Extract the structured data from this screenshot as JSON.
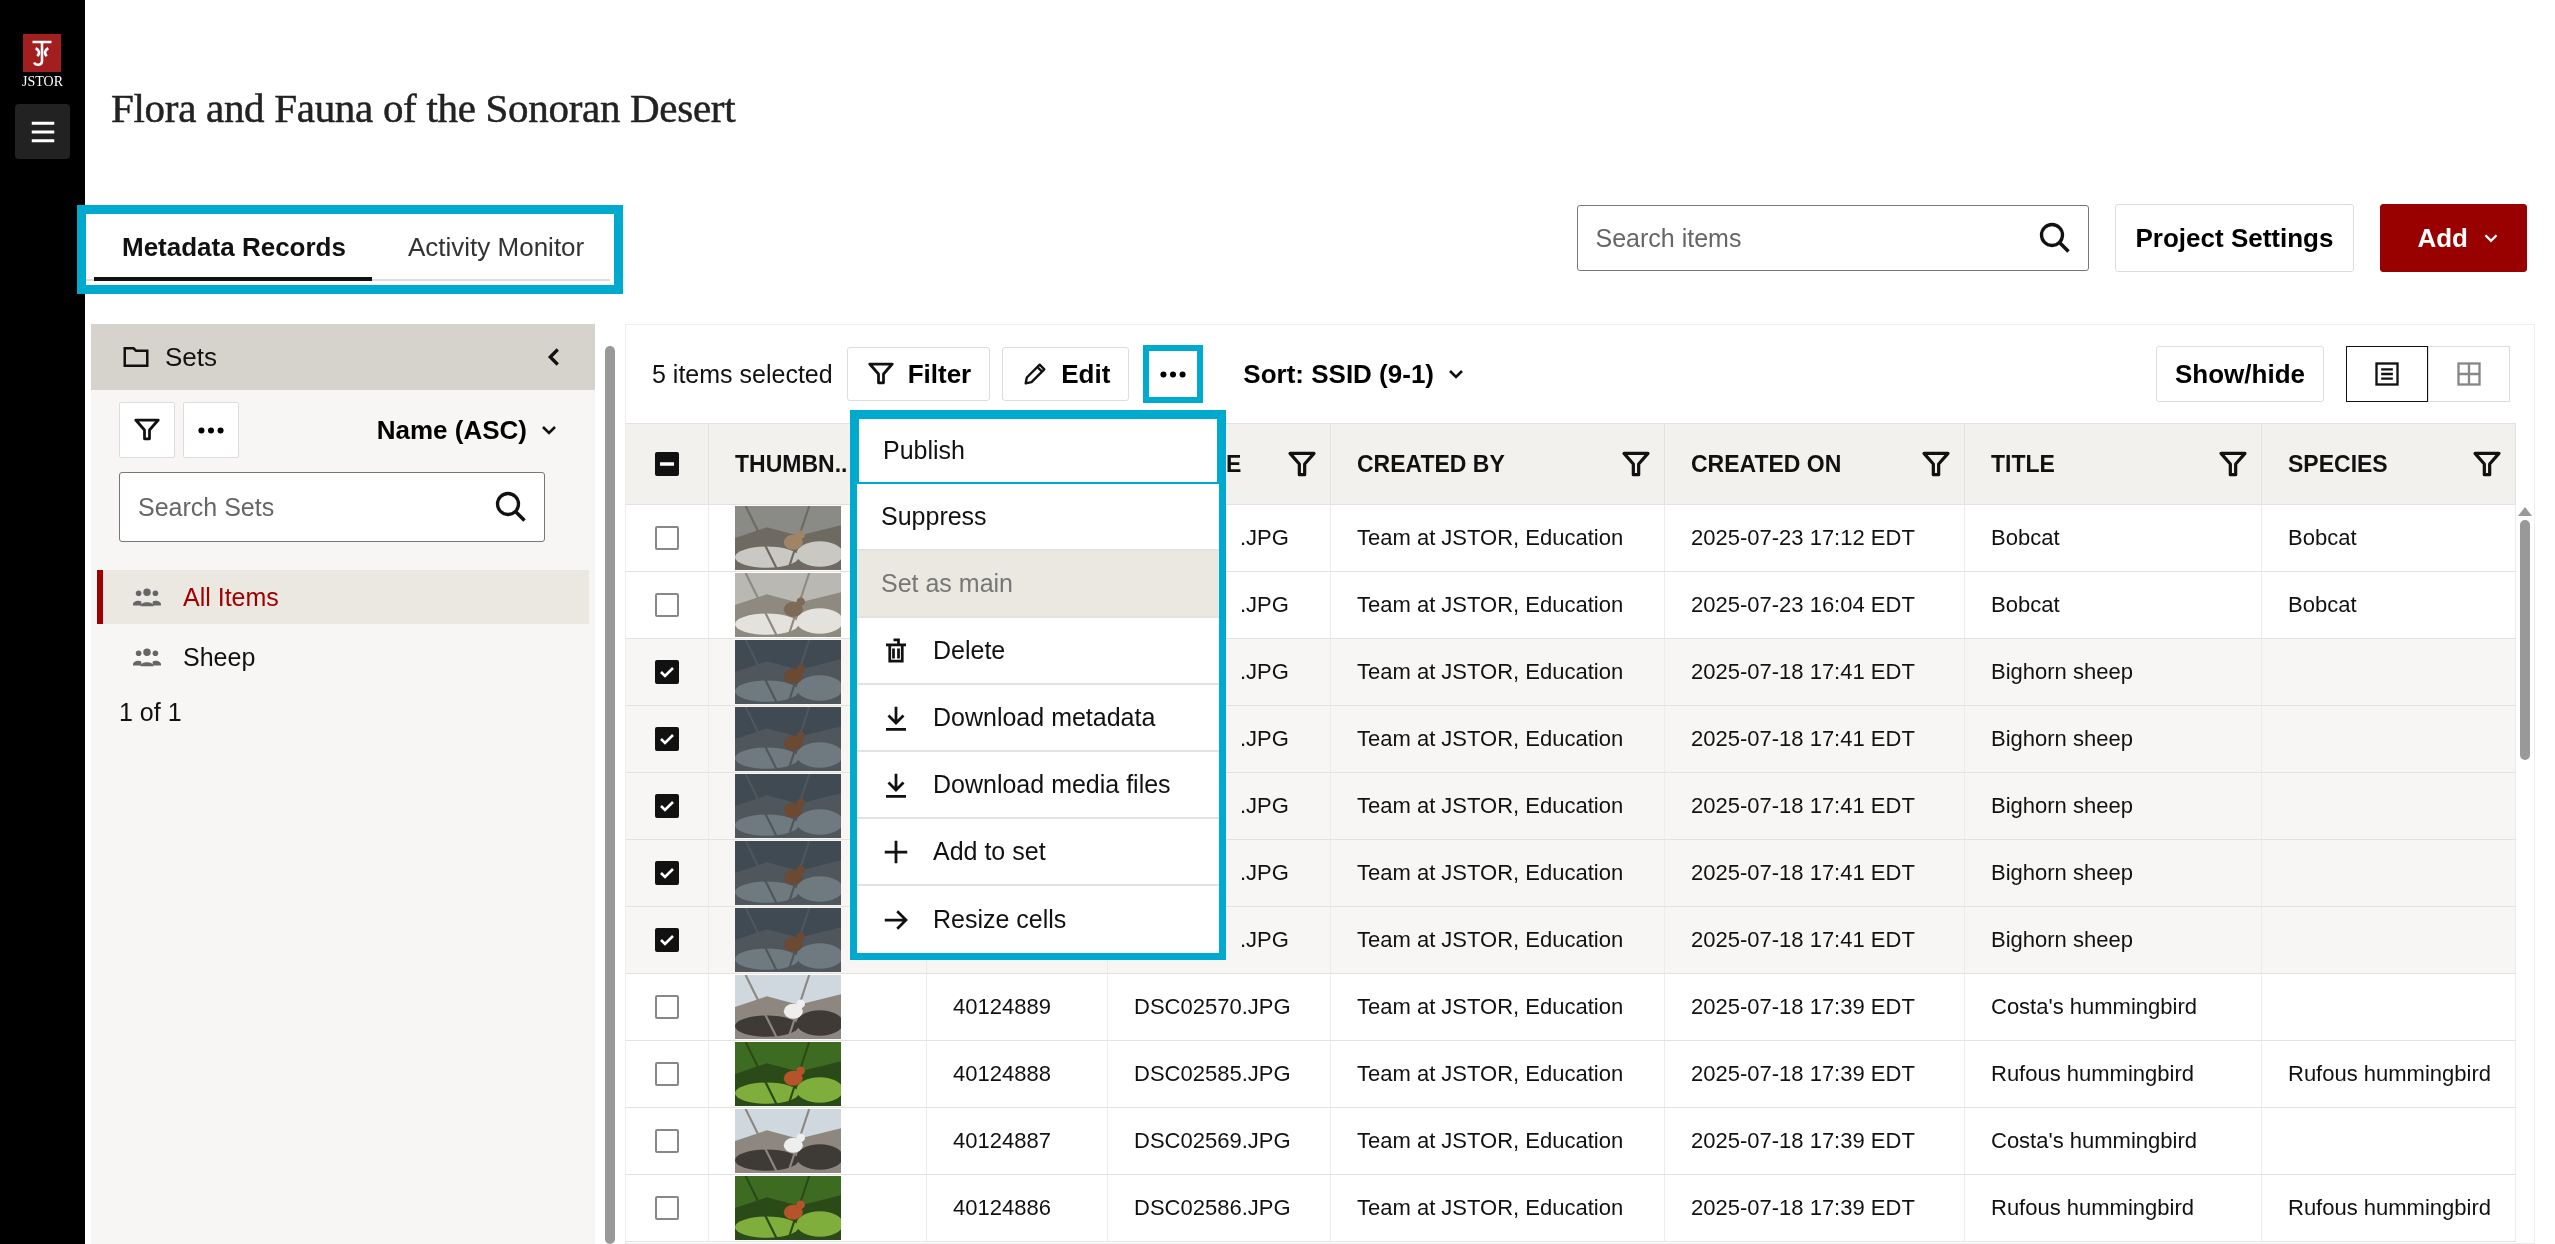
{
  "app": {
    "logo_text": "JSTOR"
  },
  "page": {
    "title": "Flora and Fauna of the Sonoran Desert"
  },
  "tabs": [
    {
      "label": "Metadata Records",
      "selected": true
    },
    {
      "label": "Activity Monitor",
      "selected": false
    }
  ],
  "header_actions": {
    "search": {
      "placeholder": "Search items"
    },
    "settings_button": "Project Settings",
    "add_button": "Add"
  },
  "sets_panel": {
    "title": "Sets",
    "sort": "Name (ASC)",
    "search": {
      "placeholder": "Search Sets"
    },
    "items": [
      {
        "label": "All Items",
        "selected": true
      },
      {
        "label": "Sheep",
        "selected": false
      }
    ],
    "pagination": "1 of 1"
  },
  "toolbar": {
    "selection_count": "5 items selected",
    "filter_button": "Filter",
    "edit_button": "Edit",
    "sort": "Sort: SSID (9-1)",
    "show_hide_button": "Show/hide",
    "views": [
      {
        "kind": "list",
        "selected": true
      },
      {
        "kind": "grid",
        "selected": false
      }
    ]
  },
  "menu": {
    "items": [
      {
        "label": "Publish",
        "kind": "plain",
        "focused": true,
        "disabled": false
      },
      {
        "label": "Suppress",
        "kind": "plain",
        "focused": false,
        "disabled": false
      },
      {
        "label": "Set as main",
        "kind": "plain",
        "focused": false,
        "disabled": true
      },
      {
        "label": "Delete",
        "kind": "trash",
        "focused": false,
        "disabled": false
      },
      {
        "label": "Download metadata",
        "kind": "download",
        "focused": false,
        "disabled": false
      },
      {
        "label": "Download media files",
        "kind": "download",
        "focused": false,
        "disabled": false
      },
      {
        "label": "Add to set",
        "kind": "plus",
        "focused": false,
        "disabled": false
      },
      {
        "label": "Resize cells",
        "kind": "arrow",
        "focused": false,
        "disabled": false
      }
    ]
  },
  "table": {
    "select_all_indeterminate": true,
    "thumbnail_header": "THUMBN..",
    "columns": [
      "E",
      "CREATED BY",
      "CREATED ON",
      "TITLE",
      "SPECIES"
    ],
    "rows": [
      {
        "checked": false,
        "column_4": ".JPG",
        "created_by": "Team at JSTOR, Education",
        "created_on": "2025-07-23 17:12 EDT",
        "title": "Bobcat",
        "species": "Bobcat"
      },
      {
        "checked": false,
        "column_4": ".JPG",
        "created_by": "Team at JSTOR, Education",
        "created_on": "2025-07-23 16:04 EDT",
        "title": "Bobcat",
        "species": "Bobcat"
      },
      {
        "checked": true,
        "column_4": ".JPG",
        "created_by": "Team at JSTOR, Education",
        "created_on": "2025-07-18 17:41 EDT",
        "title": "Bighorn sheep"
      },
      {
        "checked": true,
        "column_4": ".JPG",
        "created_by": "Team at JSTOR, Education",
        "created_on": "2025-07-18 17:41 EDT",
        "title": "Bighorn sheep"
      },
      {
        "checked": true,
        "column_4": ".JPG",
        "created_by": "Team at JSTOR, Education",
        "created_on": "2025-07-18 17:41 EDT",
        "title": "Bighorn sheep"
      },
      {
        "checked": true,
        "column_4": ".JPG",
        "created_by": "Team at JSTOR, Education",
        "created_on": "2025-07-18 17:41 EDT",
        "title": "Bighorn sheep"
      },
      {
        "checked": true,
        "column_4": ".JPG",
        "created_by": "Team at JSTOR, Education",
        "created_on": "2025-07-18 17:41 EDT",
        "title": "Bighorn sheep"
      },
      {
        "checked": false,
        "column_3": "40124889",
        "column_4": "DSC02570.JPG",
        "created_by": "Team at JSTOR, Education",
        "created_on": "2025-07-18 17:39 EDT",
        "title": "Costa's hummingbird"
      },
      {
        "checked": false,
        "column_3": "40124888",
        "column_4": "DSC02585.JPG",
        "created_by": "Team at JSTOR, Education",
        "created_on": "2025-07-18 17:39 EDT",
        "title": "Rufous hummingbird",
        "species": "Rufous hummingbird"
      },
      {
        "checked": false,
        "column_3": "40124887",
        "column_4": "DSC02569.JPG",
        "created_by": "Team at JSTOR, Education",
        "created_on": "2025-07-18 17:39 EDT",
        "title": "Costa's hummingbird"
      },
      {
        "checked": false,
        "column_3": "40124886",
        "column_4": "DSC02586.JPG",
        "created_by": "Team at JSTOR, Education",
        "created_on": "2025-07-18 17:39 EDT",
        "title": "Rufous hummingbird",
        "species": "Rufous hummingbird"
      }
    ]
  }
}
